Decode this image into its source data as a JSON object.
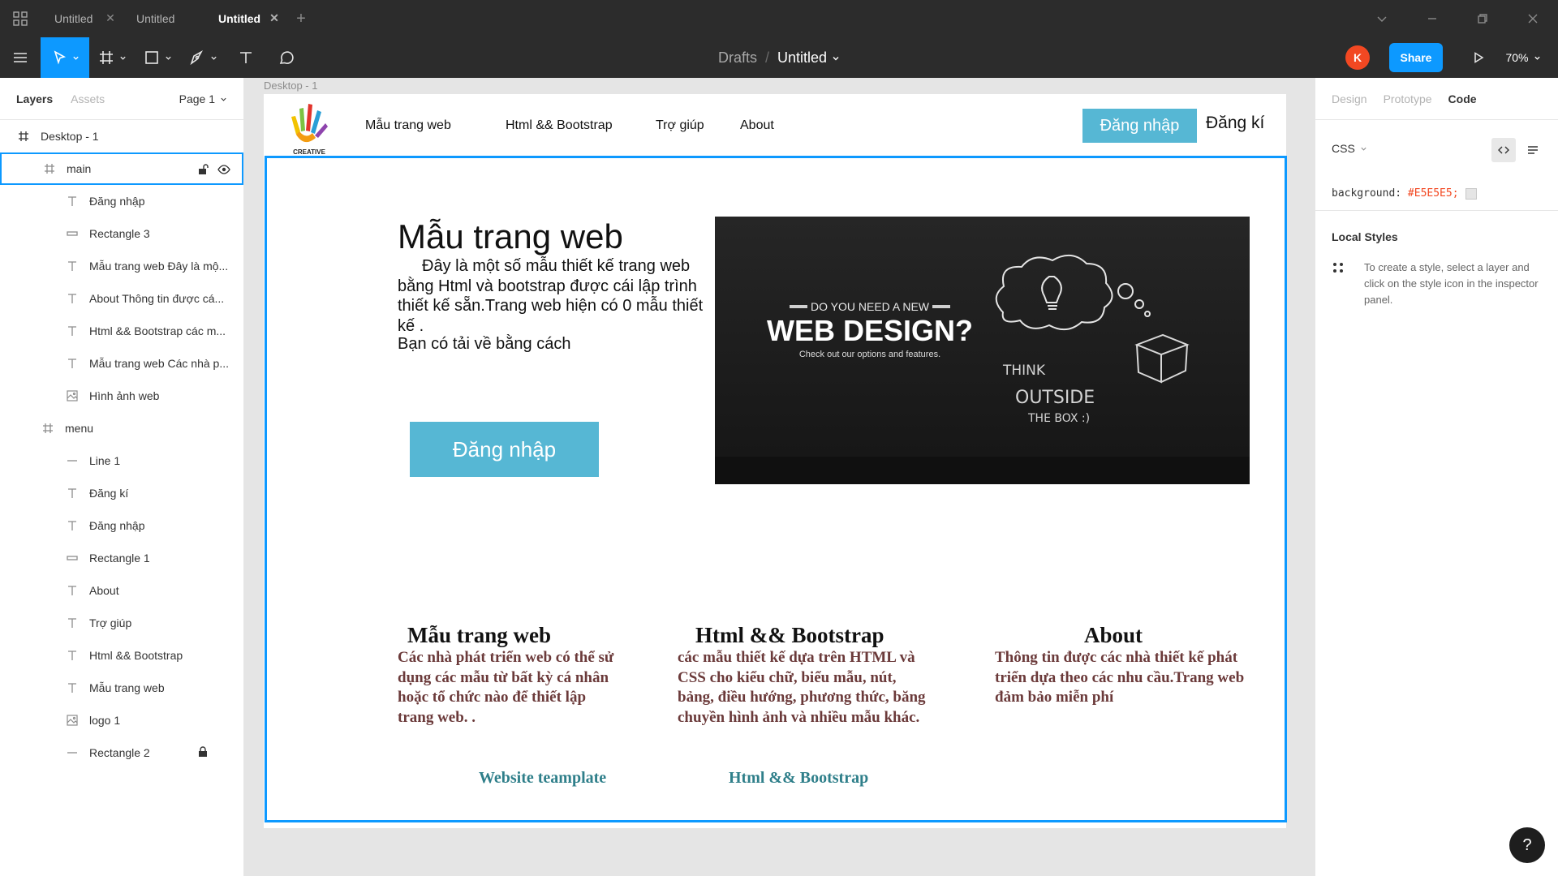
{
  "titlebar": {
    "tabs": [
      {
        "label": "Untitled",
        "active": false
      },
      {
        "label": "Untitled",
        "active": false
      },
      {
        "label": "Untitled",
        "active": true
      }
    ]
  },
  "toolbar": {
    "breadcrumb_parent": "Drafts",
    "breadcrumb_sep": "/",
    "file_name": "Untitled",
    "avatar_initial": "K",
    "share_label": "Share",
    "zoom": "70%"
  },
  "left_panel": {
    "tabs": [
      "Layers",
      "Assets"
    ],
    "active_tab": "Layers",
    "page": "Page 1",
    "layers": [
      {
        "name": "Desktop - 1",
        "type": "frame"
      },
      {
        "name": "main",
        "type": "frame",
        "selected": true
      },
      {
        "name": "Đăng nhập",
        "type": "text"
      },
      {
        "name": "Rectangle 3",
        "type": "rect"
      },
      {
        "name": "Mẫu trang web Đây là mộ...",
        "type": "text"
      },
      {
        "name": "About Thông tin được cá...",
        "type": "text"
      },
      {
        "name": "Html && Bootstrap các m...",
        "type": "text"
      },
      {
        "name": "Mẫu trang web Các nhà p...",
        "type": "text"
      },
      {
        "name": "Hình ảnh web",
        "type": "image"
      },
      {
        "name": "menu",
        "type": "frame"
      },
      {
        "name": "Line 1",
        "type": "line"
      },
      {
        "name": "Đăng kí",
        "type": "text"
      },
      {
        "name": "Đăng nhập",
        "type": "text"
      },
      {
        "name": "Rectangle 1",
        "type": "rect"
      },
      {
        "name": "About",
        "type": "text"
      },
      {
        "name": "Trợ giúp",
        "type": "text"
      },
      {
        "name": "Html && Bootstrap",
        "type": "text"
      },
      {
        "name": "Mẫu trang web",
        "type": "text"
      },
      {
        "name": "logo 1",
        "type": "image"
      },
      {
        "name": "Rectangle 2",
        "type": "line",
        "locked": true
      }
    ]
  },
  "right_panel": {
    "tabs": [
      "Design",
      "Prototype",
      "Code"
    ],
    "active_tab": "Code",
    "language": "CSS",
    "css_property": "background:",
    "css_value": "#E5E5E5;",
    "local_styles_title": "Local Styles",
    "local_styles_hint": "To create a style, select a layer and click on the style icon in the inspector panel."
  },
  "canvas": {
    "frame_label": "Desktop - 1",
    "background_color": "#E5E5E5",
    "site": {
      "logo_text": "CREATIVE",
      "nav": [
        "Mẫu trang web",
        "Html && Bootstrap",
        "Trợ giúp",
        "About"
      ],
      "login_btn": "Đăng nhập",
      "signup": "Đăng kí",
      "hero_title": "Mẫu trang web",
      "hero_body": "Đây là một số mẫu thiết kế trang web bằng Html và bootstrap được cái lập trình thiết kế sẵn.Trang web hiện có 0 mẫu thiết kế .",
      "hero_body2": "Bạn có tải về bằng cách",
      "hero_btn": "Đăng nhập",
      "image": {
        "kicker": "DO YOU NEED A NEW",
        "headline": "WEB DESIGN?",
        "sub": "Check out our options and features.",
        "think": "THINK",
        "outside": "OUTSIDE",
        "the_box": "THE BOX :)"
      },
      "features": [
        {
          "title": "Mẫu trang web",
          "text": "Các nhà phát triển web có thể sử dụng các mẫu từ bất kỳ cá nhân hoặc tổ chức nào để thiết lập trang web. .",
          "link": "Website teamplate"
        },
        {
          "title": "Html && Bootstrap",
          "text": "các mẫu thiết kế dựa trên HTML và CSS cho kiểu chữ, biểu mẫu, nút, bảng, điều hướng, phương thức, băng chuyền hình ảnh và nhiều mẫu khác.",
          "link": "Html && Bootstrap"
        },
        {
          "title": "About",
          "text": "Thông tin được các nhà thiết kế phát triển dựa theo các nhu cầu.Trang web đảm bảo miễn phí",
          "link": ""
        }
      ]
    }
  },
  "colors": {
    "accent": "#0d99ff",
    "site_button": "#56b7d4",
    "avatar": "#f24822",
    "feature_text": "#6b3a3a",
    "feature_link": "#2f7f8a"
  }
}
